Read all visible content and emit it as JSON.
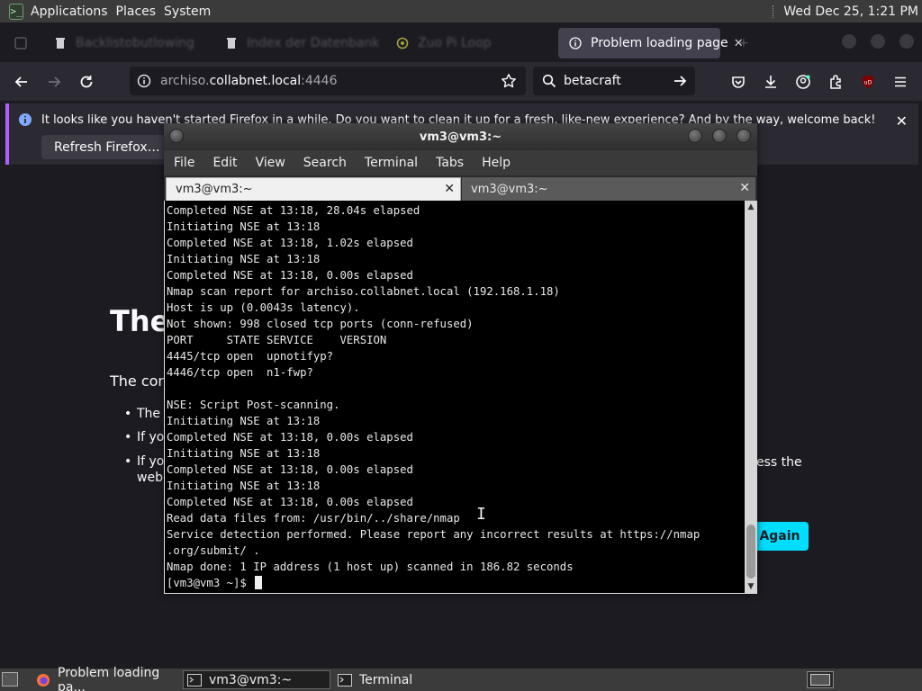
{
  "top_panel": {
    "menus": [
      "Applications",
      "Places",
      "System"
    ],
    "clock": "Wed Dec 25,  1:21 PM"
  },
  "browser": {
    "tabs": [
      {
        "label": "Backlistobutlowing",
        "icon": "trash-icon",
        "active": false
      },
      {
        "label": "Index der Datenbank",
        "icon": "trash-icon",
        "active": false
      },
      {
        "label": "Zuo Pi Loop",
        "icon": "circle-icon",
        "active": false
      },
      {
        "label": "Problem loading page",
        "icon": "info-icon",
        "active": true
      }
    ],
    "url_host": "archiso.",
    "url_domain": "collabnet.local",
    "url_port": ":4446",
    "search_value": "betacraft",
    "notification": {
      "text": "It looks like you haven't started Firefox in a while. Do you want to clean it up for a fresh, like-new experience? And by the way, welcome back!",
      "button": "Refresh Firefox…"
    },
    "page": {
      "title": "The",
      "body": "The con",
      "bullets": [
        "The",
        "If yo",
        "If yo"
      ],
      "bullet_extra": "web",
      "bullet_tail": "ess the",
      "try_again": "Again"
    }
  },
  "terminal": {
    "title": "vm3@vm3:~",
    "menu": [
      "File",
      "Edit",
      "View",
      "Search",
      "Terminal",
      "Tabs",
      "Help"
    ],
    "tabs": [
      "vm3@vm3:~",
      "vm3@vm3:~"
    ],
    "lines": [
      "Completed NSE at 13:18, 28.04s elapsed",
      "Initiating NSE at 13:18",
      "Completed NSE at 13:18, 1.02s elapsed",
      "Initiating NSE at 13:18",
      "Completed NSE at 13:18, 0.00s elapsed",
      "Nmap scan report for archiso.collabnet.local (192.168.1.18)",
      "Host is up (0.0043s latency).",
      "Not shown: 998 closed tcp ports (conn-refused)",
      "PORT     STATE SERVICE    VERSION",
      "4445/tcp open  upnotifyp?",
      "4446/tcp open  n1-fwp?",
      "",
      "NSE: Script Post-scanning.",
      "Initiating NSE at 13:18",
      "Completed NSE at 13:18, 0.00s elapsed",
      "Initiating NSE at 13:18",
      "Completed NSE at 13:18, 0.00s elapsed",
      "Initiating NSE at 13:18",
      "Completed NSE at 13:18, 0.00s elapsed",
      "Read data files from: /usr/bin/../share/nmap",
      "Service detection performed. Please report any incorrect results at https://nmap",
      ".org/submit/ .",
      "Nmap done: 1 IP address (1 host up) scanned in 186.82 seconds"
    ],
    "prompt": "[vm3@vm3 ~]$ "
  },
  "taskbar": {
    "tasks": [
      {
        "label": "Problem loading pa...",
        "icon": "firefox-icon",
        "active": false
      },
      {
        "label": "vm3@vm3:~",
        "icon": "terminal-icon",
        "active": true
      },
      {
        "label": "Terminal",
        "icon": "terminal-icon",
        "active": false
      }
    ]
  },
  "colors": {
    "accent": "#00ddff",
    "notice_border": "#b25dff",
    "terminal_bg": "#000000"
  }
}
